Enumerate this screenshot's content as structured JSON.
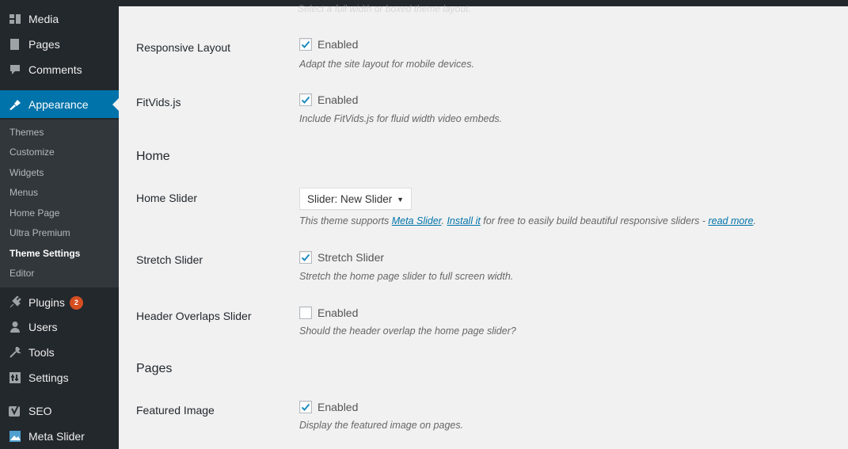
{
  "sidebar": {
    "items": [
      {
        "label": "Media",
        "icon": "media-icon"
      },
      {
        "label": "Pages",
        "icon": "pages-icon"
      },
      {
        "label": "Comments",
        "icon": "comments-icon"
      },
      {
        "label": "Appearance",
        "icon": "appearance-icon"
      },
      {
        "label": "Plugins",
        "icon": "plugins-icon",
        "badge": "2"
      },
      {
        "label": "Users",
        "icon": "users-icon"
      },
      {
        "label": "Tools",
        "icon": "tools-icon"
      },
      {
        "label": "Settings",
        "icon": "settings-icon"
      },
      {
        "label": "SEO",
        "icon": "seo-icon"
      },
      {
        "label": "Meta Slider",
        "icon": "meta-slider-icon"
      }
    ],
    "submenu": [
      "Themes",
      "Customize",
      "Widgets",
      "Menus",
      "Home Page",
      "Ultra Premium",
      "Theme Settings",
      "Editor"
    ],
    "active_submenu": "Theme Settings"
  },
  "top_faded_text": "Select a full width or boxed theme layout.",
  "settings": {
    "responsive": {
      "label": "Responsive Layout",
      "checkbox_label": "Enabled",
      "checked": true,
      "desc": "Adapt the site layout for mobile devices."
    },
    "fitvids": {
      "label": "FitVids.js",
      "checkbox_label": "Enabled",
      "checked": true,
      "desc": "Include FitVids.js for fluid width video embeds."
    },
    "home_section": "Home",
    "home_slider": {
      "label": "Home Slider",
      "select_value": "Slider: New Slider",
      "desc_before": "This theme supports ",
      "link1": "Meta Slider",
      "desc_mid1": ". ",
      "link2": "Install it",
      "desc_mid2": " for free to easily build beautiful responsive sliders - ",
      "link3": "read more",
      "desc_after": "."
    },
    "stretch_slider": {
      "label": "Stretch Slider",
      "checkbox_label": "Stretch Slider",
      "checked": true,
      "desc": "Stretch the home page slider to full screen width."
    },
    "header_overlaps": {
      "label": "Header Overlaps Slider",
      "checkbox_label": "Enabled",
      "checked": false,
      "desc": "Should the header overlap the home page slider?"
    },
    "pages_section": "Pages",
    "featured_image": {
      "label": "Featured Image",
      "checkbox_label": "Enabled",
      "checked": true,
      "desc": "Display the featured image on pages."
    }
  },
  "colors": {
    "sidebar_bg": "#23282d",
    "submenu_bg": "#32373c",
    "accent": "#0073aa",
    "badge": "#d54e21",
    "check": "#1e8cbe"
  }
}
